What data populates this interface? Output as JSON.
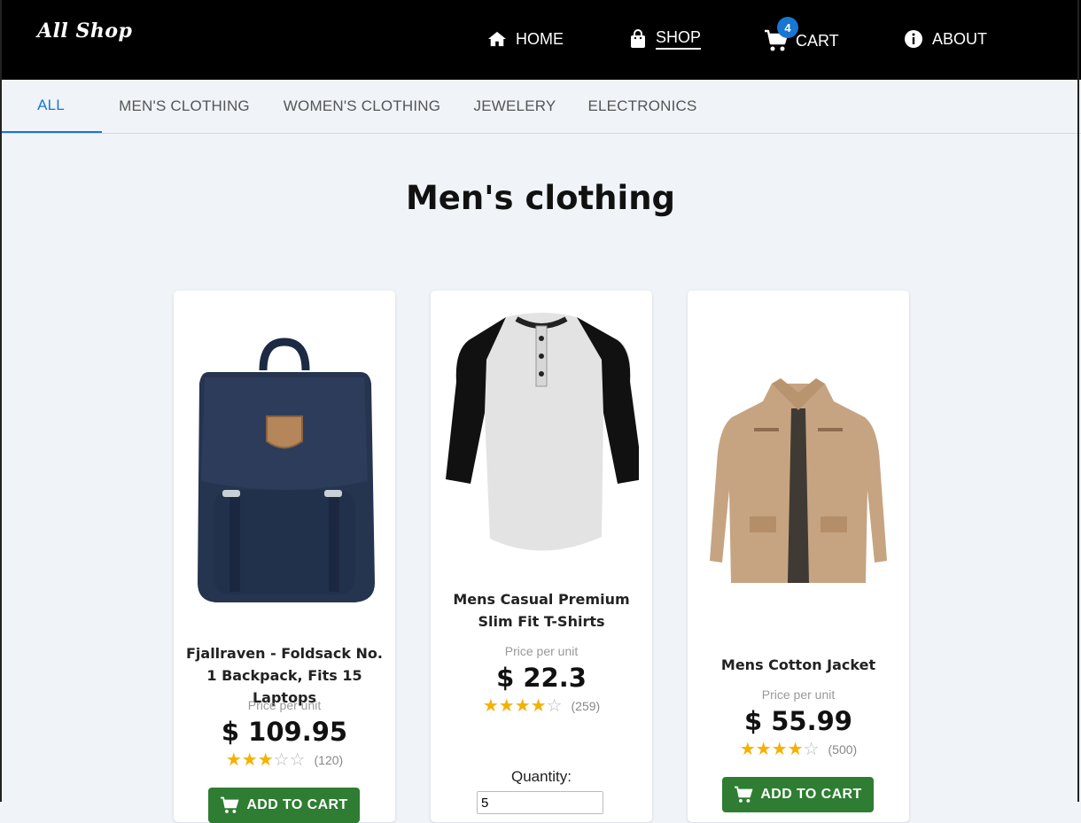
{
  "brand": "All Shop",
  "nav": {
    "home": "HOME",
    "shop": "SHOP",
    "cart": "CART",
    "cart_count": "4",
    "about": "ABOUT"
  },
  "tabs": [
    "ALL",
    "MEN'S CLOTHING",
    "WOMEN'S CLOTHING",
    "JEWELERY",
    "ELECTRONICS"
  ],
  "page_title": "Men's clothing",
  "products": [
    {
      "name": "Fjallraven - Foldsack No. 1 Backpack, Fits 15 Laptops",
      "price_label": "Price per unit",
      "price": "$ 109.95",
      "rating": 3,
      "rating_count": "(120)",
      "button": "ADD TO CART"
    },
    {
      "name": "Mens Casual Premium Slim Fit T-Shirts",
      "price_label": "Price per unit",
      "price": "$ 22.3",
      "rating": 4,
      "rating_count": "(259)",
      "quantity_label": "Quantity:",
      "quantity_value": "5"
    },
    {
      "name": "Mens Cotton Jacket",
      "price_label": "Price per unit",
      "price": "$ 55.99",
      "rating": 4,
      "rating_count": "(500)",
      "button": "ADD TO CART"
    }
  ],
  "colors": {
    "topbar": "#000000",
    "accent": "#1976d2",
    "button": "#2e7d32",
    "star": "#f5b100",
    "background": "#f0f3f8"
  }
}
